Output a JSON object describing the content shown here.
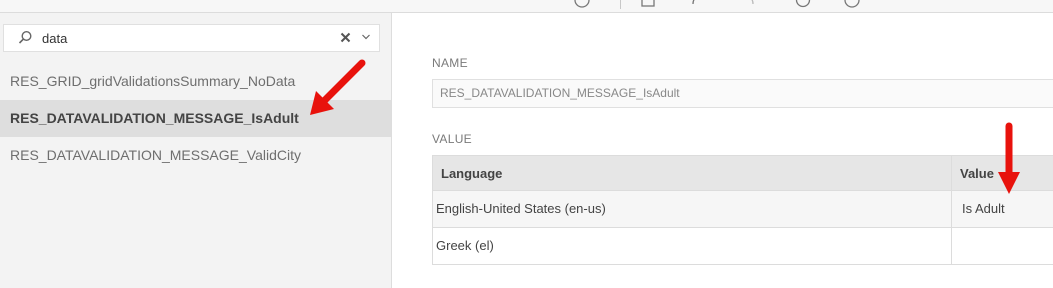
{
  "search": {
    "value": "data"
  },
  "sidebar": {
    "items": [
      {
        "label": "RES_GRID_gridValidationsSummary_NoData"
      },
      {
        "label": "RES_DATAVALIDATION_MESSAGE_IsAdult",
        "selected": true
      },
      {
        "label": "RES_DATAVALIDATION_MESSAGE_ValidCity"
      }
    ]
  },
  "main": {
    "name_label": "NAME",
    "name_value": "RES_DATAVALIDATION_MESSAGE_IsAdult",
    "value_label": "VALUE",
    "grid": {
      "headers": [
        "Language",
        "Value"
      ],
      "rows": [
        [
          "English-United States (en-us)",
          "Is Adult"
        ],
        [
          "Greek (el)",
          ""
        ]
      ]
    }
  },
  "colors": {
    "annotation_arrow": "#e8120c",
    "selected_row": "#dedede"
  },
  "icons": [
    "search-icon",
    "clear-icon",
    "chevron-down-icon",
    "help-icon",
    "save-icon",
    "undo-icon",
    "redo-icon",
    "refresh-icon",
    "info-icon"
  ]
}
